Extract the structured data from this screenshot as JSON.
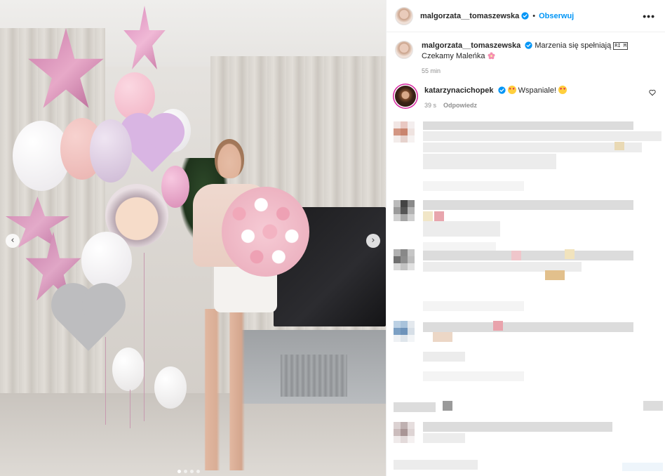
{
  "post": {
    "author": "malgorzata__tomaszewska",
    "follow_label": "Obserwuj",
    "separator": "•",
    "more_label": "•••",
    "photo_alt": "Photo post",
    "carousel": {
      "prev": "‹",
      "next": "›",
      "slides": 4,
      "active": 0
    }
  },
  "caption": {
    "username": "malgorzata__tomaszewska",
    "text": "Marzenia się spełniają",
    "emoji_box": "RI M",
    "text_after": "Czekamy Maleńka",
    "time": "55 min"
  },
  "comment": {
    "username": "katarzynacichopek",
    "text": "Wspaniale!",
    "time": "39 s",
    "reply_label": "Odpowiedz"
  },
  "colors": {
    "link_blue": "#0095f6",
    "text": "#262626",
    "muted": "#8e8e8e",
    "verified": "#0095f6"
  }
}
